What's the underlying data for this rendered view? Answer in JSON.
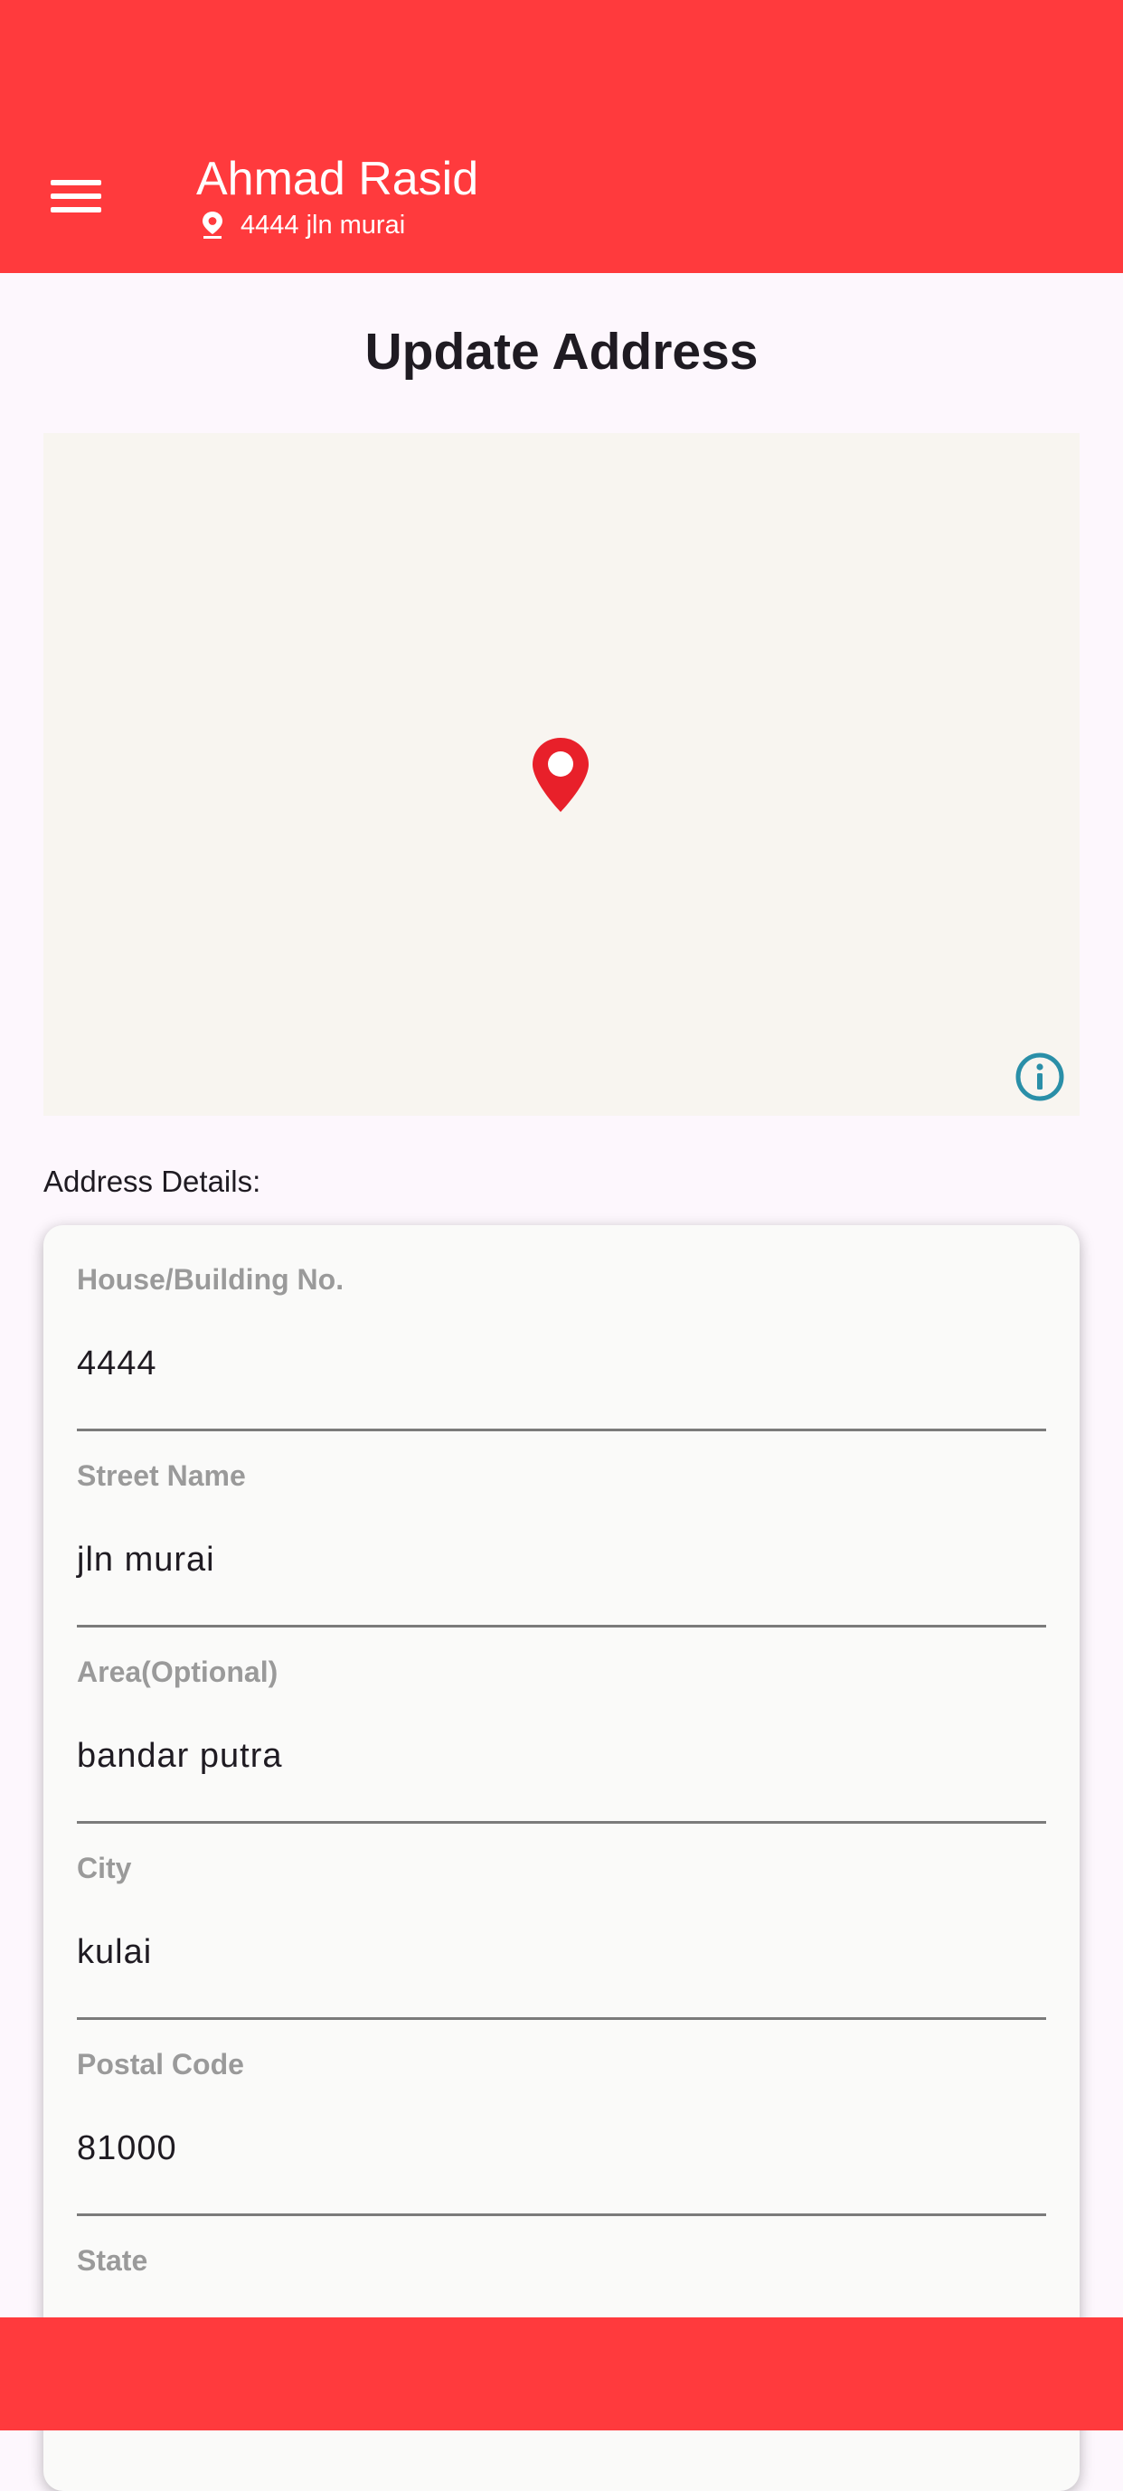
{
  "header": {
    "user_name": "Ahmad Rasid",
    "user_address": "4444 jln murai",
    "menu_icon": "hamburger-menu-icon",
    "location_icon": "map-pin-icon"
  },
  "page": {
    "title": "Update Address"
  },
  "map": {
    "marker_icon": "map-marker-icon",
    "info_icon": "info-circle-icon"
  },
  "address_details": {
    "label": "Address Details:",
    "fields": [
      {
        "label": "House/Building No.",
        "value": "4444"
      },
      {
        "label": "Street Name",
        "value": "jln murai"
      },
      {
        "label": "Area(Optional)",
        "value": "bandar putra"
      },
      {
        "label": "City",
        "value": "kulai"
      },
      {
        "label": "Postal Code",
        "value": "81000"
      },
      {
        "label": "State",
        "value": ""
      }
    ]
  },
  "colors": {
    "primary": "#ff3a3d",
    "background": "#fdf7fd",
    "map_background": "#f8f5f0",
    "marker": "#e8202a",
    "info_icon": "#2a8fa8"
  }
}
